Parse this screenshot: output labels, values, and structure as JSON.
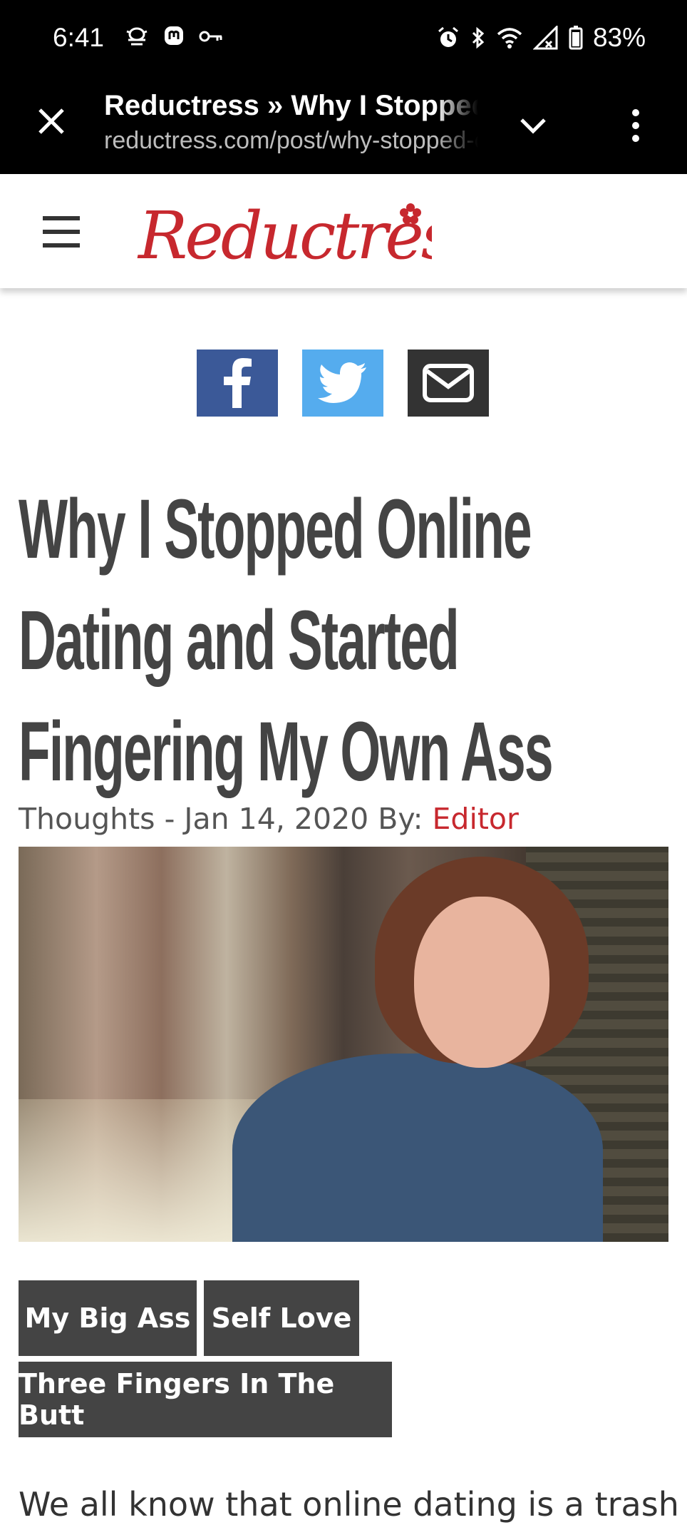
{
  "status_bar": {
    "time": "6:41",
    "battery": "83%",
    "left_icons": [
      "bug-icon",
      "mastodon-icon",
      "key-icon"
    ],
    "right_icons": [
      "alarm-icon",
      "bluetooth-icon",
      "wifi-icon",
      "signal-icon",
      "battery-icon"
    ]
  },
  "browser": {
    "title": "Reductress » Why I Stopped Online Dating",
    "url": "reductress.com/post/why-stopped-online-dating"
  },
  "site": {
    "logo": "Reductress",
    "accent_color": "#c7282e"
  },
  "share": {
    "buttons": [
      "facebook-icon",
      "twitter-icon",
      "email-icon"
    ]
  },
  "article": {
    "title": "Why I Stopped Online Dating and Started Fingering My Own Ass",
    "category": "Thoughts",
    "separator": " - ",
    "date": "Jan 14, 2020",
    "by_label": " By: ",
    "author": "Editor",
    "tags": [
      "My Big Ass",
      "Self Love",
      "Three Fingers In The Butt"
    ],
    "body_start": "We all know that online dating is a trash"
  }
}
